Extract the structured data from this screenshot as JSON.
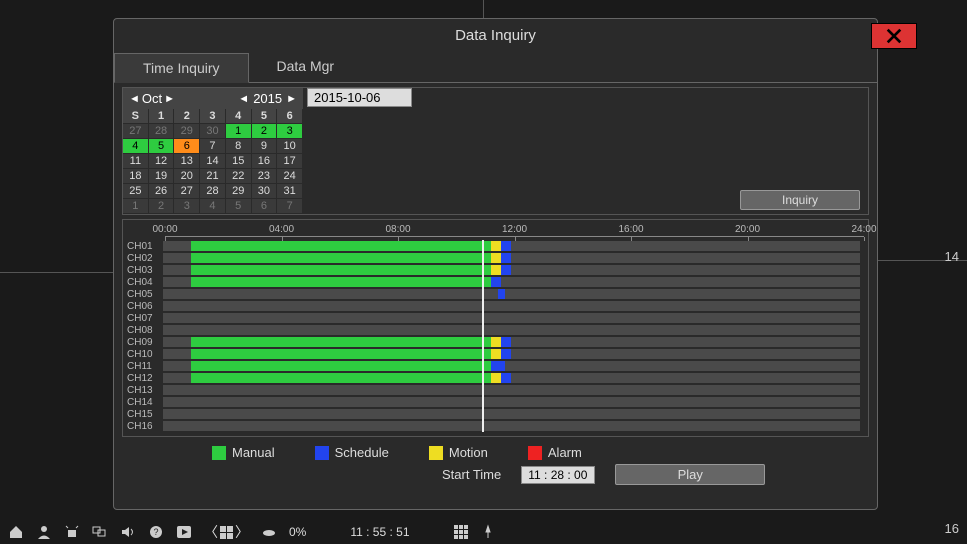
{
  "window": {
    "title": "Data Inquiry",
    "tabs": [
      "Time  Inquiry",
      "Data  Mgr"
    ],
    "active_tab": 0
  },
  "calendar": {
    "month": "Oct",
    "year": "2015",
    "day_headers": [
      "S",
      "1",
      "2",
      "3",
      "4",
      "5",
      "6"
    ],
    "weeks": [
      [
        {
          "n": "27",
          "cls": "other"
        },
        {
          "n": "28",
          "cls": "other"
        },
        {
          "n": "29",
          "cls": "other"
        },
        {
          "n": "30",
          "cls": "other"
        },
        {
          "n": "1",
          "cls": "green"
        },
        {
          "n": "2",
          "cls": "green"
        },
        {
          "n": "3",
          "cls": "green"
        }
      ],
      [
        {
          "n": "4",
          "cls": "green"
        },
        {
          "n": "5",
          "cls": "green"
        },
        {
          "n": "6",
          "cls": "orange"
        },
        {
          "n": "7",
          "cls": ""
        },
        {
          "n": "8",
          "cls": ""
        },
        {
          "n": "9",
          "cls": ""
        },
        {
          "n": "10",
          "cls": ""
        }
      ],
      [
        {
          "n": "11",
          "cls": ""
        },
        {
          "n": "12",
          "cls": ""
        },
        {
          "n": "13",
          "cls": ""
        },
        {
          "n": "14",
          "cls": ""
        },
        {
          "n": "15",
          "cls": ""
        },
        {
          "n": "16",
          "cls": ""
        },
        {
          "n": "17",
          "cls": ""
        }
      ],
      [
        {
          "n": "18",
          "cls": ""
        },
        {
          "n": "19",
          "cls": ""
        },
        {
          "n": "20",
          "cls": ""
        },
        {
          "n": "21",
          "cls": ""
        },
        {
          "n": "22",
          "cls": ""
        },
        {
          "n": "23",
          "cls": ""
        },
        {
          "n": "24",
          "cls": ""
        }
      ],
      [
        {
          "n": "25",
          "cls": ""
        },
        {
          "n": "26",
          "cls": ""
        },
        {
          "n": "27",
          "cls": ""
        },
        {
          "n": "28",
          "cls": ""
        },
        {
          "n": "29",
          "cls": ""
        },
        {
          "n": "30",
          "cls": ""
        },
        {
          "n": "31",
          "cls": ""
        }
      ],
      [
        {
          "n": "1",
          "cls": "other"
        },
        {
          "n": "2",
          "cls": "other"
        },
        {
          "n": "3",
          "cls": "other"
        },
        {
          "n": "4",
          "cls": "other"
        },
        {
          "n": "5",
          "cls": "other"
        },
        {
          "n": "6",
          "cls": "other"
        },
        {
          "n": "7",
          "cls": "other"
        }
      ]
    ]
  },
  "date_field": "2015-10-06",
  "inquiry_label": "Inquiry",
  "timeline": {
    "hours": [
      "00:00",
      "04:00",
      "08:00",
      "12:00",
      "16:00",
      "20:00",
      "24:00"
    ],
    "cursor_pct": 48,
    "channels": [
      {
        "name": "CH01",
        "segs": [
          {
            "t": "manual",
            "s": 4,
            "e": 47
          },
          {
            "t": "motion",
            "s": 47,
            "e": 48.5
          },
          {
            "t": "schedule",
            "s": 48.5,
            "e": 50
          }
        ]
      },
      {
        "name": "CH02",
        "segs": [
          {
            "t": "manual",
            "s": 4,
            "e": 47
          },
          {
            "t": "motion",
            "s": 47,
            "e": 48.5
          },
          {
            "t": "schedule",
            "s": 48.5,
            "e": 50
          }
        ]
      },
      {
        "name": "CH03",
        "segs": [
          {
            "t": "manual",
            "s": 4,
            "e": 47
          },
          {
            "t": "motion",
            "s": 47,
            "e": 48.5
          },
          {
            "t": "schedule",
            "s": 48.5,
            "e": 50
          }
        ]
      },
      {
        "name": "CH04",
        "segs": [
          {
            "t": "manual",
            "s": 4,
            "e": 47
          },
          {
            "t": "schedule",
            "s": 47,
            "e": 48.5
          }
        ]
      },
      {
        "name": "CH05",
        "segs": [
          {
            "t": "schedule",
            "s": 48,
            "e": 49
          }
        ]
      },
      {
        "name": "CH06",
        "segs": []
      },
      {
        "name": "CH07",
        "segs": []
      },
      {
        "name": "CH08",
        "segs": []
      },
      {
        "name": "CH09",
        "segs": [
          {
            "t": "manual",
            "s": 4,
            "e": 47
          },
          {
            "t": "motion",
            "s": 47,
            "e": 48.5
          },
          {
            "t": "schedule",
            "s": 48.5,
            "e": 50
          }
        ]
      },
      {
        "name": "CH10",
        "segs": [
          {
            "t": "manual",
            "s": 4,
            "e": 47
          },
          {
            "t": "motion",
            "s": 47,
            "e": 48.5
          },
          {
            "t": "schedule",
            "s": 48.5,
            "e": 50
          }
        ]
      },
      {
        "name": "CH11",
        "segs": [
          {
            "t": "manual",
            "s": 4,
            "e": 47
          },
          {
            "t": "schedule",
            "s": 47,
            "e": 49
          }
        ]
      },
      {
        "name": "CH12",
        "segs": [
          {
            "t": "manual",
            "s": 4,
            "e": 47
          },
          {
            "t": "motion",
            "s": 47,
            "e": 48.5
          },
          {
            "t": "schedule",
            "s": 48.5,
            "e": 50
          }
        ]
      },
      {
        "name": "CH13",
        "segs": []
      },
      {
        "name": "CH14",
        "segs": []
      },
      {
        "name": "CH15",
        "segs": []
      },
      {
        "name": "CH16",
        "segs": []
      }
    ]
  },
  "legend": {
    "manual": {
      "label": "Manual",
      "color": "#2ecc40"
    },
    "schedule": {
      "label": "Schedule",
      "color": "#2244ee"
    },
    "motion": {
      "label": "Motion",
      "color": "#eedd22"
    },
    "alarm": {
      "label": "Alarm",
      "color": "#ee2222"
    }
  },
  "start_time_label": "Start  Time",
  "start_time_value": "11 : 28 : 00",
  "play_label": "Play",
  "footer": {
    "percent": "0%",
    "clock": "11 : 55 : 51"
  },
  "bg": {
    "label14": "14",
    "label16": "16"
  }
}
